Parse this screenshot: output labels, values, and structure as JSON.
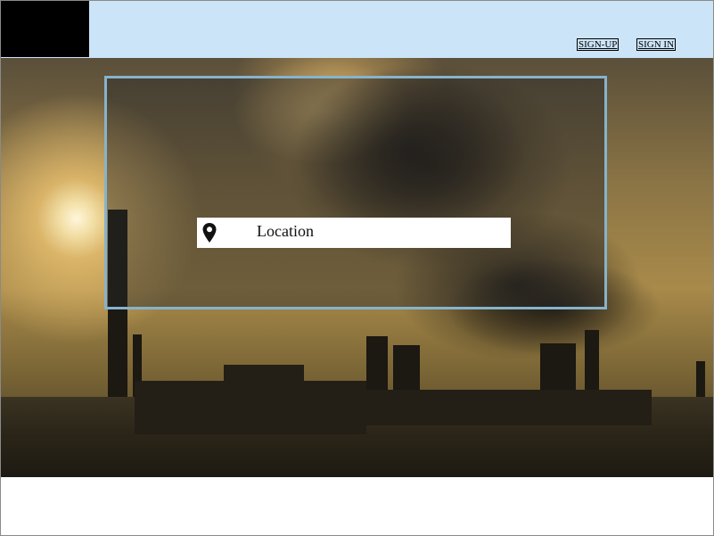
{
  "header": {
    "logo": "logo",
    "links": {
      "signup": "SIGN-UP",
      "signin": "SIGN  IN"
    }
  },
  "hero": {
    "background_image": "industrial plant with smoke at sunset",
    "search": {
      "value": "Location",
      "icon": "map-pin-icon"
    }
  },
  "colors": {
    "header_bg": "#cce4f7",
    "logo_bg": "#000000",
    "overlay_border": "#86b3cc"
  }
}
